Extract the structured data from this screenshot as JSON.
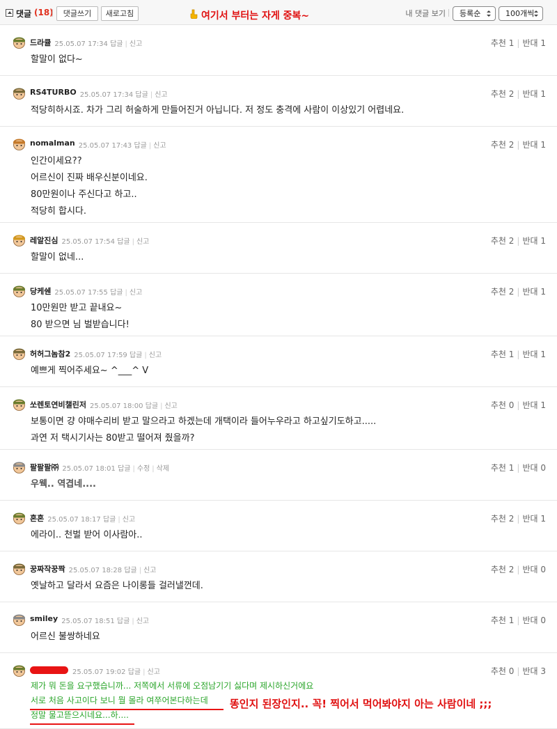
{
  "header": {
    "title": "댓글",
    "count": "(18)",
    "write_button": "댓글쓰기",
    "refresh_button": "새로고침",
    "note": "여기서 부터는 자게 중복~",
    "my_comments": "내 댓글 보기",
    "sort_select": "등록순",
    "page_size_select": "100개씩"
  },
  "labels": {
    "reply": "답글",
    "report": "신고",
    "edit": "수정",
    "delete": "삭제",
    "up": "추천",
    "down": "반대"
  },
  "comments": [
    {
      "nick": "드라큘",
      "date": "25.05.07 17:34",
      "up": "1",
      "down": "1",
      "lines": [
        "할말이 없다~"
      ]
    },
    {
      "nick": "RS4TURBO",
      "date": "25.05.07 17:34",
      "up": "2",
      "down": "1",
      "lines": [
        "적당히하시죠. 차가 그리 허술하게 만들어진거 아닙니다. 저 정도 충격에 사람이 이상있기 어렵네요."
      ]
    },
    {
      "nick": "nomalman",
      "date": "25.05.07 17:43",
      "up": "2",
      "down": "1",
      "lines": [
        "인간이세요??",
        "어르신이 진짜 배우신분이네요.",
        "80만원이나 주신다고 하고..",
        "적당히 합시다."
      ]
    },
    {
      "nick": "레알진심",
      "date": "25.05.07 17:54",
      "up": "2",
      "down": "1",
      "lines": [
        "할말이 없네..."
      ]
    },
    {
      "nick": "당케쉔",
      "date": "25.05.07 17:55",
      "up": "2",
      "down": "1",
      "lines": [
        "10만원만 받고 끝내요~",
        "80 받으면 님 벌받습니다!"
      ]
    },
    {
      "nick": "허허그놈참2",
      "date": "25.05.07 17:59",
      "up": "1",
      "down": "1",
      "lines": [
        "예쁘게 찍어주세요~ ^___^ V"
      ]
    },
    {
      "nick": "쏘렌토연비챌린저",
      "date": "25.05.07 18:00",
      "up": "0",
      "down": "1",
      "lines": [
        "보통이면 걍 야매수리비 받고 말으라고 하겠는데 개택이라 들어누우라고 하고싶기도하고.....",
        "과연 저 택시기사는 80받고 떨어져 줬을까?"
      ]
    },
    {
      "nick": "팔팔팔㈜",
      "date": "25.05.07 18:01",
      "up": "1",
      "down": "0",
      "lines": [
        "우웩.. 역겹네...."
      ]
    },
    {
      "nick": "혼혼",
      "date": "25.05.07 18:17",
      "up": "2",
      "down": "1",
      "lines": [
        "에라이.. 천벌 받어 이사람아.."
      ]
    },
    {
      "nick": "꿍짜작꿍짝",
      "date": "25.05.07 18:28",
      "up": "2",
      "down": "0",
      "lines": [
        "옛날하고 달라서 요즘은 나이롱들 걸러낼껀데."
      ]
    },
    {
      "nick": "smiley",
      "date": "25.05.07 18:51",
      "up": "1",
      "down": "0",
      "lines": [
        "어르신 불쌍하네요"
      ]
    },
    {
      "nick": "",
      "date": "25.05.07 19:02",
      "up": "0",
      "down": "3",
      "lines": [
        "제가 뭐 돈을 요구했습니까... 저쪽에서 서류에 오점남기기 싫다며 제시하신거에요",
        "서로 처음 사고이다 보니 뭘 몰라 여쭈어본다하는데",
        "정말 물고뜯으시네요...하...."
      ]
    }
  ],
  "last_comment_note": "똥인지 된장인지.. 꼭! 찍어서 먹어봐야지 아는 사람이네 ;;;",
  "colors": {
    "accent_red": "#e01010",
    "green_text": "#2aa52a",
    "muted": "#999999"
  }
}
